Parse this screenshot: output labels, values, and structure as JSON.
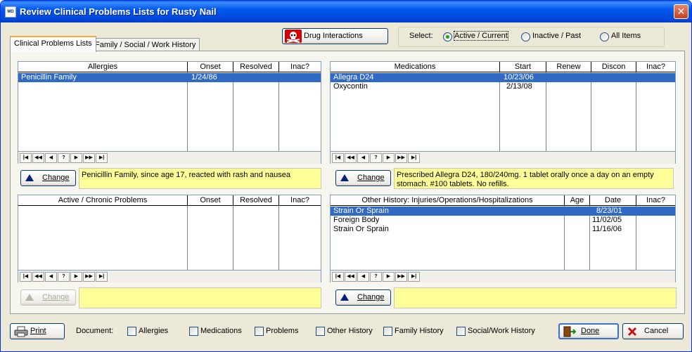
{
  "window": {
    "title": "Review Clinical Problems Lists for Rusty Nail",
    "close_label": "✕"
  },
  "tabs": [
    {
      "label": "Clinical Problems Lists",
      "active": true
    },
    {
      "label": "Family / Social / Work History",
      "active": false
    }
  ],
  "toolbar": {
    "drug_interactions_label": "Drug Interactions"
  },
  "select": {
    "label": "Select:",
    "options": [
      {
        "label": "Active / Current",
        "selected": true
      },
      {
        "label": "Inactive / Past",
        "selected": false
      },
      {
        "label": "All Items",
        "selected": false
      }
    ]
  },
  "nav_buttons": [
    "|◀",
    "◀◀",
    "◀",
    "?",
    "▶",
    "▶▶",
    "▶|"
  ],
  "allergies": {
    "columns": [
      "Allergies",
      "Onset",
      "Resolved",
      "Inac?"
    ],
    "rows": [
      {
        "cells": [
          "Penicillin Family",
          "1/24/86",
          "",
          ""
        ],
        "selected": true
      }
    ],
    "change_label": "Change",
    "note": "Penicillin Family, since age 17, reacted with rash and nausea"
  },
  "medications": {
    "columns": [
      "Medications",
      "Start",
      "Renew",
      "Discon",
      "Inac?"
    ],
    "rows": [
      {
        "cells": [
          "Allegra D24",
          "10/23/06",
          "",
          "",
          ""
        ],
        "selected": true
      },
      {
        "cells": [
          "Oxycontin",
          "2/13/08",
          "",
          "",
          ""
        ],
        "selected": false
      }
    ],
    "change_label": "Change",
    "note": "Prescribed Allegra D24, 180/240mg. 1 tablet orally once a day on an empty stomach. #100 tablets. No refills."
  },
  "problems": {
    "columns": [
      "Active / Chronic Problems",
      "Onset",
      "Resolved",
      "Inac?"
    ],
    "rows": [],
    "change_label": "Change",
    "note": ""
  },
  "history": {
    "columns": [
      "Other History: Injuries/Operations/Hospitalizations",
      "Age",
      "Date",
      "Inac?"
    ],
    "rows": [
      {
        "cells": [
          "Strain Or Sprain",
          "",
          "8/23/01",
          ""
        ],
        "selected": true
      },
      {
        "cells": [
          "Foreign Body",
          "",
          "11/02/05",
          ""
        ],
        "selected": false
      },
      {
        "cells": [
          "Strain Or Sprain",
          "",
          "11/16/06",
          ""
        ],
        "selected": false
      }
    ],
    "change_label": "Change",
    "note": ""
  },
  "footer": {
    "print_label": "Print",
    "document_label": "Document:",
    "checkboxes": [
      "Allergies",
      "Medications",
      "Problems",
      "Other History",
      "Family History",
      "Social/Work History"
    ],
    "done_label": "Done",
    "cancel_label": "Cancel"
  },
  "colors": {
    "titlebar": "#0058ee",
    "selection": "#316ac5",
    "note_bg": "#ffff99"
  }
}
